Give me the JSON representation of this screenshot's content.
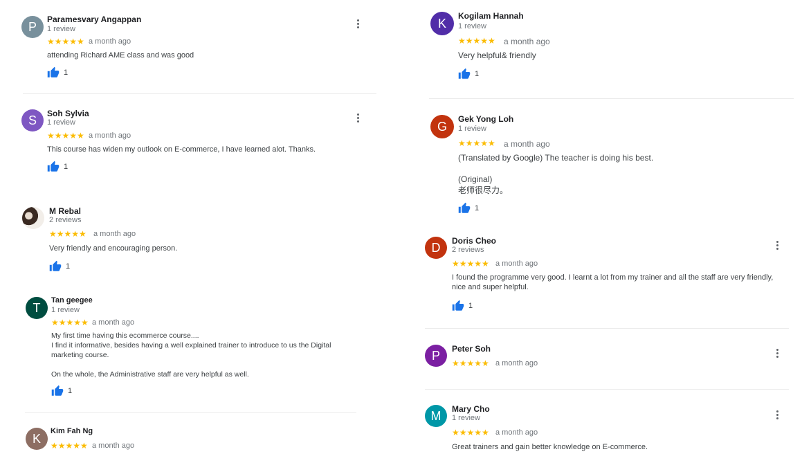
{
  "reviews": [
    {
      "initial": "P",
      "color": "#78909c",
      "name": "Paramesvary Angappan",
      "count": "1 review",
      "stars": "★★★★★",
      "time": "a month ago",
      "text": "attending Richard AME class and was good",
      "likes": "1"
    },
    {
      "initial": "S",
      "color": "#7e57c2",
      "name": "Soh Sylvia",
      "count": "1 review",
      "stars": "★★★★★",
      "time": "a month ago",
      "text": "This course has widen my outlook on E-commerce, I have learned alot. Thanks.",
      "likes": "1"
    },
    {
      "initial": "",
      "color": "#3a2a22",
      "name": "M Rebal",
      "count": "2 reviews",
      "stars": "★★★★★",
      "time": "a month ago",
      "text": "Very friendly and encouraging person.",
      "likes": "1"
    },
    {
      "initial": "T",
      "color": "#004d40",
      "name": "Tan geegee",
      "count": "1 review",
      "stars": "★★★★★",
      "time": "a month ago",
      "text": "My first time having this ecommerce course....\nI find it informative, besides having a well explained trainer to introduce to us the Digital marketing course.\n\nOn the whole, the Administrative staff are very helpful as well.",
      "likes": "1"
    },
    {
      "initial": "K",
      "color": "#8d6e63",
      "name": "Kim Fah Ng",
      "count": "",
      "stars": "★★★★★",
      "time": "a month ago",
      "text": "",
      "likes": ""
    },
    {
      "initial": "K",
      "color": "#512da8",
      "name": "Kogilam Hannah",
      "count": "1 review",
      "stars": "★★★★★",
      "time": "a month ago",
      "text": "Very helpful& friendly",
      "likes": "1"
    },
    {
      "initial": "G",
      "color": "#c2330e",
      "name": "Gek Yong Loh",
      "count": "1 review",
      "stars": "★★★★★",
      "time": "a month ago",
      "text": "(Translated by Google) The teacher is doing his best.\n\n(Original)\n老师很尽力。",
      "likes": "1"
    },
    {
      "initial": "D",
      "color": "#c2330e",
      "name": "Doris Cheo",
      "count": "2 reviews",
      "stars": "★★★★★",
      "time": "a month ago",
      "text": "I found the programme very good. I learnt a lot from my trainer  and all the staff are very friendly, nice and super helpful.",
      "likes": "1"
    },
    {
      "initial": "P",
      "color": "#7b1fa2",
      "name": "Peter Soh",
      "count": "",
      "stars": "★★★★★",
      "time": "a month ago",
      "text": "",
      "likes": ""
    },
    {
      "initial": "M",
      "color": "#0097a7",
      "name": "Mary Cho",
      "count": "1 review",
      "stars": "★★★★★",
      "time": "a month ago",
      "text": "Great trainers and gain better knowledge on E-commerce.",
      "likes": ""
    }
  ],
  "colors": {
    "star": "#fbbc04",
    "like": "#1a73e8",
    "divider": "#ebebeb"
  },
  "icons": {
    "like": "thumbs-up-icon",
    "menu": "more-vert-icon"
  }
}
